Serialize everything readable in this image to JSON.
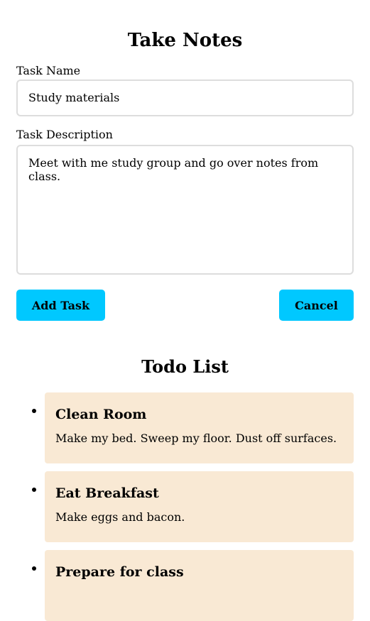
{
  "form": {
    "title": "Take Notes",
    "task_name_label": "Task Name",
    "task_name_value": "Study materials",
    "task_description_label": "Task Description",
    "task_description_value": "Meet with me study group and go over notes from class.",
    "add_button": "Add Task",
    "cancel_button": "Cancel"
  },
  "todo": {
    "title": "Todo List",
    "items": [
      {
        "title": "Clean Room",
        "description": "Make my bed. Sweep my floor. Dust off surfaces."
      },
      {
        "title": "Eat Breakfast",
        "description": "Make eggs and bacon."
      },
      {
        "title": "Prepare for class",
        "description": ""
      }
    ]
  },
  "colors": {
    "button_bg": "#00c8ff",
    "card_bg": "#f9e9d4",
    "field_border": "#dddddd"
  }
}
